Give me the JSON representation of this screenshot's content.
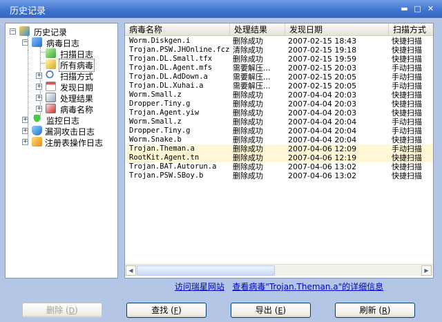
{
  "window": {
    "title": "历史记录",
    "minimize_glyph": "▬",
    "maximize_glyph": "□",
    "close_glyph": "✕"
  },
  "tree": {
    "expander_open": "−",
    "expander_closed": "+",
    "root": {
      "label": "历史记录",
      "icon": "cube-icon"
    },
    "virus_log": {
      "label": "病毒日志",
      "icon": "virus-log-icon"
    },
    "children": [
      {
        "label": "扫描日志",
        "icon": "document-icon"
      },
      {
        "label": "所有病毒",
        "icon": "all-viruses-icon"
      },
      {
        "label": "扫描方式",
        "icon": "magnifier-icon"
      },
      {
        "label": "发现日期",
        "icon": "calendar-icon"
      },
      {
        "label": "处理结果",
        "icon": "result-icon"
      },
      {
        "label": "病毒名称",
        "icon": "bug-icon"
      }
    ],
    "others": [
      {
        "label": "监控日志",
        "icon": "umbrella-icon"
      },
      {
        "label": "漏洞攻击日志",
        "icon": "shield-icon"
      },
      {
        "label": "注册表操作日志",
        "icon": "registry-icon"
      }
    ]
  },
  "table": {
    "columns": [
      "病毒名称",
      "处理结果",
      "发现日期",
      "扫描方式"
    ],
    "rows": [
      [
        "Worm.Diskgen.i",
        "删除成功",
        "2007-02-15 18:43",
        "快捷扫描"
      ],
      [
        "Trojan.PSW.JHOnline.fcz",
        "清除成功",
        "2007-02-15 19:18",
        "快捷扫描"
      ],
      [
        "Trojan.DL.Small.tfx",
        "删除成功",
        "2007-02-15 19:59",
        "快捷扫描"
      ],
      [
        "Trojan.DL.Agent.mfs",
        "需要解压...",
        "2007-02-15 20:03",
        "手动扫描"
      ],
      [
        "Trojan.DL.AdDown.a",
        "需要解压...",
        "2007-02-15 20:05",
        "手动扫描"
      ],
      [
        "Trojan.DL.Xuhai.a",
        "需要解压...",
        "2007-02-15 20:05",
        "手动扫描"
      ],
      [
        "Worm.Small.z",
        "删除成功",
        "2007-04-04 20:03",
        "快捷扫描"
      ],
      [
        "Dropper.Tiny.g",
        "删除成功",
        "2007-04-04 20:03",
        "快捷扫描"
      ],
      [
        "Trojan.Agent.yiw",
        "删除成功",
        "2007-04-04 20:03",
        "快捷扫描"
      ],
      [
        "Worm.Small.z",
        "删除成功",
        "2007-04-04 20:04",
        "手动扫描"
      ],
      [
        "Dropper.Tiny.g",
        "删除成功",
        "2007-04-04 20:04",
        "手动扫描"
      ],
      [
        "Worm.Snake.b",
        "删除成功",
        "2007-04-04 20:04",
        "快捷扫描"
      ],
      [
        "Trojan.Theman.a",
        "删除成功",
        "2007-04-06 12:09",
        "手动扫描"
      ],
      [
        "RootKit.Agent.tn",
        "删除成功",
        "2007-04-06 12:19",
        "快捷扫描"
      ],
      [
        "Trojan.BAT.Autorun.a",
        "删除成功",
        "2007-04-06 13:02",
        "快捷扫描"
      ],
      [
        "Trojan.PSW.SBoy.b",
        "删除成功",
        "2007-04-06 13:02",
        "快捷扫描"
      ]
    ],
    "highlighted_rows": [
      12,
      13
    ],
    "scroll_left_glyph": "◀",
    "scroll_right_glyph": "▶"
  },
  "link": {
    "site_text": "访问瑞星网站",
    "detail_text": "查看病毒\"Trojan.Theman.a\"的详细信息"
  },
  "buttons": {
    "delete": {
      "label": "删除",
      "key": "D",
      "enabled": false
    },
    "find": {
      "label": "查找",
      "key": "F"
    },
    "export": {
      "label": "导出",
      "key": "E"
    },
    "refresh": {
      "label": "刷新",
      "key": "R"
    }
  },
  "colors": {
    "titlebar": "#3f73cf",
    "client_bg": "#b3c6e6",
    "highlight_row": "#fff7d6",
    "link": "#0000cc"
  }
}
